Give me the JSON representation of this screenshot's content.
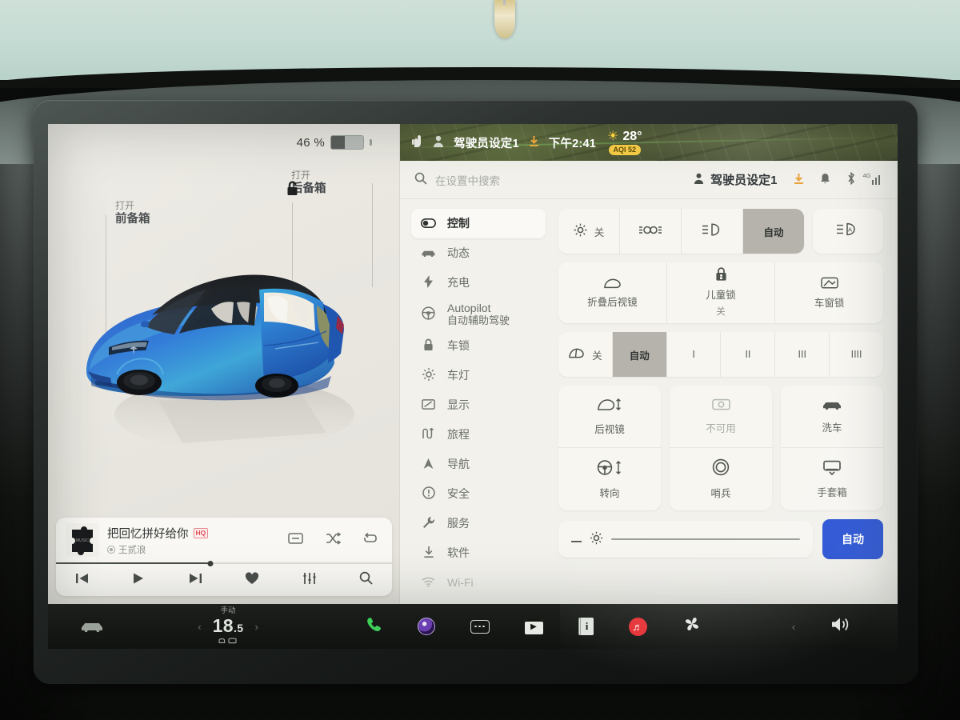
{
  "status_left": {
    "battery_percent": "46 %",
    "battery_icon": "battery-icon"
  },
  "statusbar": {
    "hand_icon": "hand-icon",
    "person_icon": "person-icon",
    "profile": "驾驶员设定1",
    "download_icon": "download-icon",
    "time": "下午2:41",
    "sun_icon": "sun-icon",
    "temperature": "28°",
    "aqi": "AQI 52",
    "aqi_color": "#f2c944"
  },
  "search": {
    "icon": "search-icon",
    "placeholder": "在设置中搜索",
    "profile": "驾驶员设定1",
    "person_icon": "person-icon",
    "download_icon": "download-icon",
    "bell_icon": "bell-icon",
    "bluetooth_icon": "bluetooth-icon",
    "signal_label": "4G"
  },
  "sidebar": {
    "items": [
      {
        "label": "控制",
        "icon": "toggle-icon",
        "selected": true
      },
      {
        "label": "动态",
        "icon": "car-icon",
        "selected": false
      },
      {
        "label": "充电",
        "icon": "bolt-icon",
        "selected": false
      },
      {
        "label": "Autopilot",
        "sub": "自动辅助驾驶",
        "icon": "steering-wheel-icon",
        "selected": false
      },
      {
        "label": "车锁",
        "icon": "lock-icon",
        "selected": false
      },
      {
        "label": "车灯",
        "icon": "headlight-icon",
        "selected": false
      },
      {
        "label": "显示",
        "icon": "display-icon",
        "selected": false
      },
      {
        "label": "旅程",
        "icon": "trip-icon",
        "selected": false
      },
      {
        "label": "导航",
        "icon": "navigation-icon",
        "selected": false
      },
      {
        "label": "安全",
        "icon": "safety-icon",
        "selected": false
      },
      {
        "label": "服务",
        "icon": "wrench-icon",
        "selected": false
      },
      {
        "label": "软件",
        "icon": "download-icon",
        "selected": false
      },
      {
        "label": "Wi-Fi",
        "icon": "wifi-icon",
        "selected": false
      }
    ]
  },
  "car_card": {
    "frunk_action": "打开",
    "frunk_label": "前备箱",
    "trunk_action": "打开",
    "trunk_label": "后备箱",
    "lock_icon": "unlocked-padlock-icon",
    "charge_port_icon": "charge-plug-icon",
    "car_color": "#2f6fd0"
  },
  "media": {
    "title": "把回忆拼好给你",
    "artist": "王贰浪",
    "quality_badge": "HQ",
    "album_art_icon": "puzzle-piece-icon",
    "progress_percent": 46,
    "tools": [
      {
        "icon": "lyrics-icon"
      },
      {
        "icon": "shuffle-icon"
      },
      {
        "icon": "repeat-icon"
      }
    ],
    "controls": [
      {
        "icon": "previous-icon"
      },
      {
        "icon": "play-icon"
      },
      {
        "icon": "next-icon"
      },
      {
        "icon": "heart-icon"
      },
      {
        "icon": "equalizer-icon"
      },
      {
        "icon": "search-icon"
      }
    ]
  },
  "controls": {
    "lights_group": [
      {
        "label": "关",
        "icon": "sun-off-icon",
        "active": false
      },
      {
        "label": "",
        "icon": "parking-light-icon",
        "active": false
      },
      {
        "label": "",
        "icon": "low-beam-icon",
        "active": false
      },
      {
        "label": "自动",
        "icon": "",
        "active": true
      }
    ],
    "high_beam": {
      "icon": "auto-high-beam-icon",
      "label": ""
    },
    "mirror_group": [
      {
        "label": "折叠后视镜",
        "sub": "",
        "icon": "mirror-icon"
      },
      {
        "label": "儿童锁",
        "sub": "关",
        "icon": "child-lock-icon"
      },
      {
        "label": "车窗锁",
        "sub": "",
        "icon": "window-lock-icon"
      }
    ],
    "wiper_group": [
      {
        "label": "关",
        "icon": "wiper-icon",
        "active": false
      },
      {
        "label": "自动",
        "icon": "",
        "active": true
      },
      {
        "label": "I",
        "icon": "",
        "active": false
      },
      {
        "label": "II",
        "icon": "",
        "active": false
      },
      {
        "label": "III",
        "icon": "",
        "active": false
      },
      {
        "label": "IIII",
        "icon": "",
        "active": false
      }
    ],
    "tiles": [
      [
        {
          "label": "后视镜",
          "icon": "mirror-adjust-icon",
          "disabled": false
        },
        {
          "label": "转向",
          "icon": "steering-adjust-icon",
          "disabled": false
        }
      ],
      [
        {
          "label": "不可用",
          "icon": "camera-icon",
          "disabled": true
        },
        {
          "label": "哨兵",
          "icon": "sentry-icon",
          "disabled": false
        }
      ],
      [
        {
          "label": "洗车",
          "icon": "car-wash-icon",
          "disabled": false
        },
        {
          "label": "手套箱",
          "icon": "glovebox-icon",
          "disabled": false
        }
      ]
    ],
    "brightness": {
      "minus_icon": "minus-icon",
      "sun_icon": "brightness-icon",
      "value_percent": 0,
      "auto_label": "自动",
      "auto_color": "#2b54d4"
    }
  },
  "taskbar": {
    "car_icon": "car-icon",
    "climate_mode": "手动",
    "temperature_int": "18",
    "temperature_frac": ".5",
    "seat_icon": "seat-vent-icon",
    "left_chevron": "‹",
    "right_chevron": "›",
    "apps": [
      {
        "icon": "phone-icon"
      },
      {
        "icon": "camera-icon"
      },
      {
        "icon": "app-launcher-icon"
      },
      {
        "icon": "media-player-icon"
      },
      {
        "icon": "info-icon"
      },
      {
        "icon": "netease-music-icon"
      },
      {
        "icon": "fan-icon"
      }
    ],
    "volume_icon": "volume-icon",
    "volume_chevron": "‹"
  }
}
